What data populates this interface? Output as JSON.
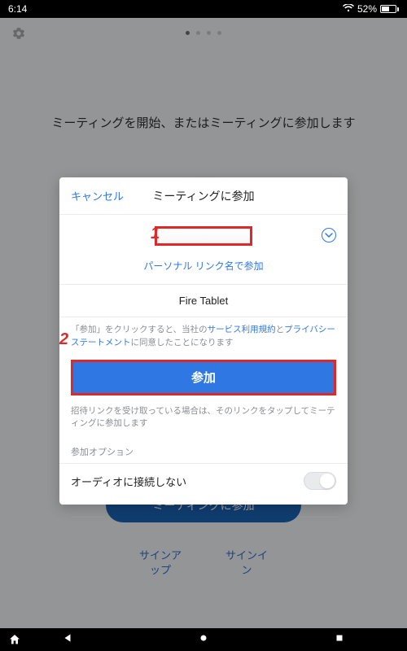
{
  "status": {
    "time": "6:14",
    "battery_pct": "52%",
    "battery_fill_pct": 52
  },
  "background": {
    "headline": "ミーティングを開始、またはミーティングに参加します",
    "join_button": "ミーティングに参加",
    "signup_label": "サインア\nップ",
    "signin_label": "サインイ\nン"
  },
  "modal": {
    "cancel": "キャンセル",
    "title": "ミーティングに参加",
    "meeting_id_placeholder": "",
    "personal_link": "パーソナル リンク名で参加",
    "device_name": "Fire Tablet",
    "consent_prefix": "「参加」をクリックすると、当社の",
    "tos": "サービス利用規約",
    "consent_and": "と",
    "privacy": "プライバシー ステートメント",
    "consent_suffix": "に同意したことになります",
    "join": "参加",
    "invite_note": "招待リンクを受け取っている場合は、そのリンクをタップしてミーティングに参加します",
    "options_label": "参加オプション",
    "audio_toggle_label": "オーディオに接続しない"
  },
  "annotations": {
    "1": "1",
    "2": "2"
  }
}
